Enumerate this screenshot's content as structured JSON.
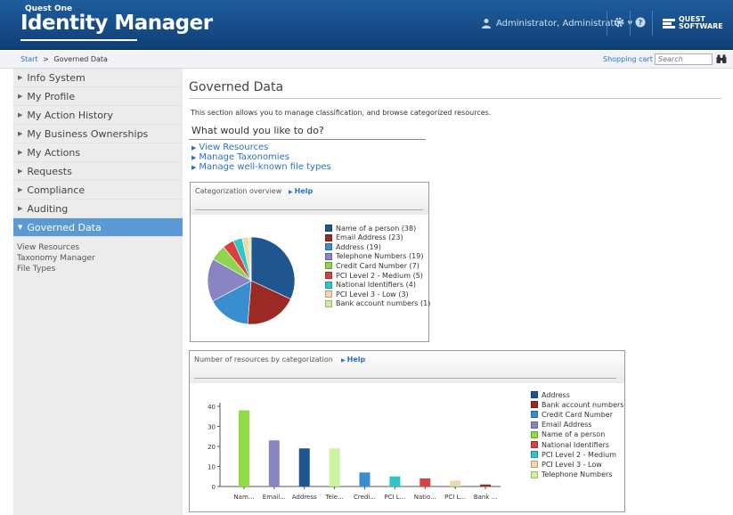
{
  "header": {
    "product_small": "Quest One",
    "product_title": "Identity Manager",
    "user_label": "Administrator, Administrator",
    "vendor_line1": "QUEST",
    "vendor_line2": "SOFTWARE"
  },
  "icons": {
    "user": "person-icon",
    "settings": "gear-icon",
    "help": "question-icon",
    "search": "binoculars-icon"
  },
  "breadcrumb": {
    "start": "Start",
    "sep": ">",
    "current": "Governed Data"
  },
  "toolbar": {
    "cart_label": "Shopping cart",
    "search_placeholder": "Search"
  },
  "sidebar": {
    "items": [
      {
        "label": "Info System"
      },
      {
        "label": "My Profile"
      },
      {
        "label": "My Action History"
      },
      {
        "label": "My Business Ownerships"
      },
      {
        "label": "My Actions"
      },
      {
        "label": "Requests"
      },
      {
        "label": "Compliance"
      },
      {
        "label": "Auditing"
      },
      {
        "label": "Governed Data"
      }
    ],
    "sub_items": [
      {
        "label": "View Resources"
      },
      {
        "label": "Taxonomy Manager"
      },
      {
        "label": "File Types"
      }
    ]
  },
  "main": {
    "title": "Governed Data",
    "description": "This section allows you to manage classification, and browse categorized resources.",
    "question": "What would you like to do?",
    "links": [
      {
        "label": "View Resources"
      },
      {
        "label": "Manage Taxonomies"
      },
      {
        "label": "Manage well-known file types"
      }
    ]
  },
  "panels": {
    "overview": {
      "title": "Categorization overview",
      "help": "Help"
    },
    "resources": {
      "title": "Number of resources by categorization",
      "help": "Help"
    }
  },
  "colors": {
    "header": "#1a4f8a",
    "active_nav": "#5b9bd5",
    "link": "#2a72c4"
  },
  "chart_data": [
    {
      "type": "pie",
      "title": "Categorization overview",
      "slices": [
        {
          "label": "Name of a person",
          "value": 38,
          "legend": "Name of a person (38)",
          "color": "#1f5690"
        },
        {
          "label": "Email Address",
          "value": 23,
          "legend": "Email Address (23)",
          "color": "#9b2a24"
        },
        {
          "label": "Address",
          "value": 19,
          "legend": "Address (19)",
          "color": "#3a8ed0"
        },
        {
          "label": "Telephone Numbers",
          "value": 19,
          "legend": "Telephone Numbers (19)",
          "color": "#8984c2"
        },
        {
          "label": "Credit Card Number",
          "value": 7,
          "legend": "Credit Card Number (7)",
          "color": "#8fd44e"
        },
        {
          "label": "PCI Level 2 - Medium",
          "value": 5,
          "legend": "PCI Level 2 - Medium (5)",
          "color": "#d94141"
        },
        {
          "label": "National Identifiers",
          "value": 4,
          "legend": "National Identifiers (4)",
          "color": "#2ec6c9"
        },
        {
          "label": "PCI Level 3 - Low",
          "value": 3,
          "legend": "PCI Level 3 - Low (3)",
          "color": "#efd8b0"
        },
        {
          "label": "Bank account numbers",
          "value": 1,
          "legend": "Bank account numbers (1)",
          "color": "#c9ee9c"
        }
      ]
    },
    {
      "type": "bar",
      "title": "Number of resources by categorization",
      "categories": [
        "Nam...",
        "Email...",
        "Address",
        "Tele...",
        "Credi...",
        "PCI L...",
        "Natio...",
        "PCI L...",
        "Bank ..."
      ],
      "values": [
        38,
        23,
        19,
        19,
        7,
        5,
        4,
        3,
        1
      ],
      "bar_colors": [
        "#8fdc45",
        "#8984c2",
        "#1f5690",
        "#cdf2a0",
        "#3a8ed0",
        "#2ec6c9",
        "#d94141",
        "#efd8b0",
        "#9b2a24"
      ],
      "ylim": [
        0,
        40
      ],
      "yticks": [
        0,
        10,
        20,
        30,
        40
      ],
      "grid": false,
      "legend_position": "right",
      "legend": [
        {
          "label": "Address",
          "color": "#1f5690"
        },
        {
          "label": "Bank account numbers",
          "color": "#9b2a24"
        },
        {
          "label": "Credit Card Number",
          "color": "#3a8ed0"
        },
        {
          "label": "Email Address",
          "color": "#8984c2"
        },
        {
          "label": "Name of a person",
          "color": "#8fdc45"
        },
        {
          "label": "National Identifiers",
          "color": "#d94141"
        },
        {
          "label": "PCI Level 2 - Medium",
          "color": "#2ec6c9"
        },
        {
          "label": "PCI Level 3 - Low",
          "color": "#efd8b0"
        },
        {
          "label": "Telephone Numbers",
          "color": "#cdf2a0"
        }
      ]
    }
  ]
}
